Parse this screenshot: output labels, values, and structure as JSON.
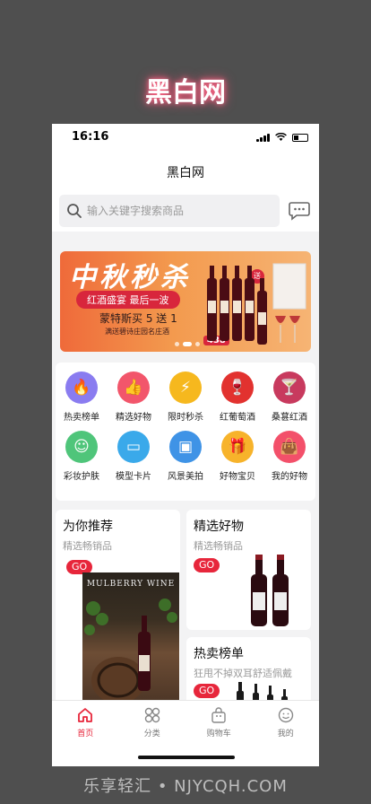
{
  "overlay": {
    "title": "黑白网",
    "watermark": "乐享轻汇 • NJYCQH.COM"
  },
  "status": {
    "time": "16:16"
  },
  "nav": {
    "title": "黑白网"
  },
  "search": {
    "placeholder": "输入关键字搜索商品"
  },
  "banner": {
    "title": "中秋秒杀",
    "pill": "红酒盛宴 最后一波",
    "headline": "蒙特斯买 5 送 1",
    "sub": "满送碧诗庄园名庄酒",
    "price": "438",
    "tag": "送"
  },
  "categories": [
    {
      "label": "热卖榜单",
      "icon": "flame-icon",
      "color": "#8a7cf0",
      "glyph": "🔥"
    },
    {
      "label": "精选好物",
      "icon": "thumbs-up-icon",
      "color": "#f2566b",
      "glyph": "👍"
    },
    {
      "label": "限时秒杀",
      "icon": "lightning-icon",
      "color": "#f6b81e",
      "glyph": "⚡"
    },
    {
      "label": "红葡萄酒",
      "icon": "wine-bottle-icon",
      "color": "#e2322f",
      "glyph": "🍷"
    },
    {
      "label": "桑葚红酒",
      "icon": "wine-glass-icon",
      "color": "#c83a5e",
      "glyph": "🍸"
    },
    {
      "label": "彩妆护肤",
      "icon": "face-mask-icon",
      "color": "#4fc57a",
      "glyph": "☺"
    },
    {
      "label": "模型卡片",
      "icon": "card-icon",
      "color": "#3aa9ea",
      "glyph": "▭"
    },
    {
      "label": "风景美拍",
      "icon": "photo-icon",
      "color": "#3f93e6",
      "glyph": "▣"
    },
    {
      "label": "好物宝贝",
      "icon": "gift-icon",
      "color": "#f7b32b",
      "glyph": "🎁"
    },
    {
      "label": "我的好物",
      "icon": "shopping-bag-icon",
      "color": "#f3506a",
      "glyph": "👜"
    }
  ],
  "recommend": {
    "title": "为你推荐",
    "sub": "精选畅销品",
    "go": "GO",
    "poster_text": "MULBERRY WINE"
  },
  "featured": {
    "title": "精选好物",
    "sub": "精选畅销品",
    "go": "GO"
  },
  "hot": {
    "title": "热卖榜单",
    "sub": "狂甩不掉双耳舒适佩戴",
    "go": "GO"
  },
  "tabs": [
    {
      "label": "首页",
      "icon": "home-icon"
    },
    {
      "label": "分类",
      "icon": "grid-icon"
    },
    {
      "label": "购物车",
      "icon": "cart-icon"
    },
    {
      "label": "我的",
      "icon": "user-face-icon"
    }
  ],
  "colors": {
    "accent": "#e7263b"
  }
}
